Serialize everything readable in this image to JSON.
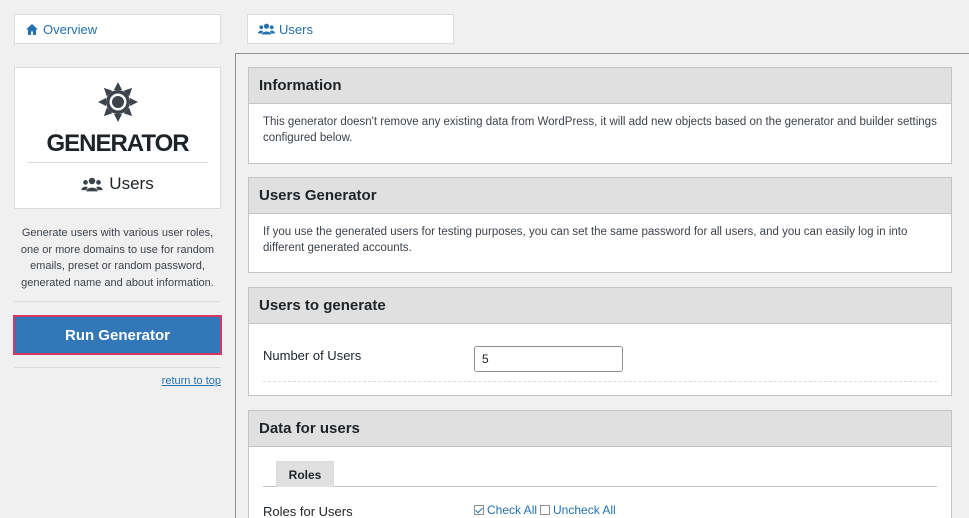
{
  "tabs": {
    "overview": {
      "label": "Overview",
      "icon": "home-icon"
    },
    "users": {
      "label": "Users",
      "icon": "users-icon"
    }
  },
  "sidebar": {
    "logo_icon": "gear-icon",
    "title": "GENERATOR",
    "section": "Users",
    "section_icon": "users-icon",
    "description": "Generate users with various user roles, one or more domains to use for random emails, preset or random password, generated name and about information.",
    "run_button": "Run Generator",
    "return_link": "return to top"
  },
  "panels": {
    "information": {
      "title": "Information",
      "body": "This generator doesn't remove any existing data from WordPress, it will add new objects based on the generator and builder settings configured below."
    },
    "users_generator": {
      "title": "Users Generator",
      "body": "If you use the generated users for testing purposes, you can set the same password for all users, and you can easily log in into different generated accounts."
    },
    "users_to_generate": {
      "title": "Users to generate",
      "number_label": "Number of Users",
      "number_value": "5"
    },
    "data_for_users": {
      "title": "Data for users",
      "roles_tab": "Roles",
      "roles_label": "Roles for Users",
      "check_all": "Check All",
      "uncheck_all": "Uncheck All"
    }
  },
  "colors": {
    "accent": "#2271b1",
    "button": "#3277b8",
    "button_border": "#d63663",
    "panel_header": "#e0e0e0"
  }
}
